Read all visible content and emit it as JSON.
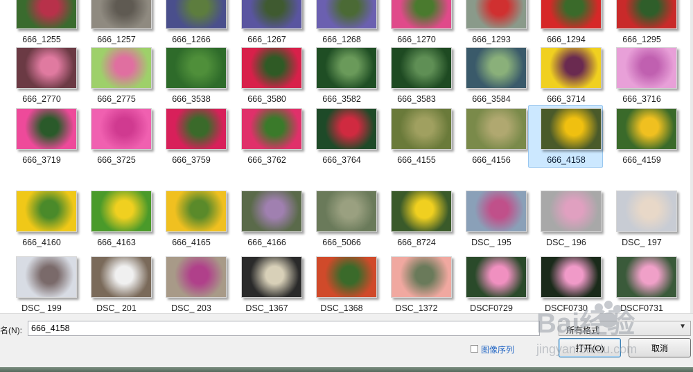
{
  "thumbnails": [
    {
      "name": "666_1255",
      "c1": "#3a6b2e",
      "c2": "#b8314a"
    },
    {
      "name": "666_1257",
      "c1": "#8f8a80",
      "c2": "#5f5a52"
    },
    {
      "name": "666_1266",
      "c1": "#4a4f8c",
      "c2": "#5d7d3e"
    },
    {
      "name": "666_1267",
      "c1": "#5a55a0",
      "c2": "#3f5a30"
    },
    {
      "name": "666_1268",
      "c1": "#6b60b0",
      "c2": "#4b6a35"
    },
    {
      "name": "666_1270",
      "c1": "#e04a8a",
      "c2": "#4a7a2e"
    },
    {
      "name": "666_1293",
      "c1": "#8a9a8a",
      "c2": "#d03030"
    },
    {
      "name": "666_1294",
      "c1": "#d62828",
      "c2": "#3a6a2a"
    },
    {
      "name": "666_1295",
      "c1": "#c92a2a",
      "c2": "#2f5e2a"
    },
    {
      "name": "666_2770",
      "c1": "#6b3a44",
      "c2": "#e07aa0"
    },
    {
      "name": "666_2775",
      "c1": "#9ed06a",
      "c2": "#e06fa0"
    },
    {
      "name": "666_3538",
      "c1": "#2e6b2a",
      "c2": "#4f8f3a"
    },
    {
      "name": "666_3580",
      "c1": "#d8204a",
      "c2": "#2f5a25"
    },
    {
      "name": "666_3582",
      "c1": "#1f4e24",
      "c2": "#6a9a5a"
    },
    {
      "name": "666_3583",
      "c1": "#1e4a22",
      "c2": "#5f8f55"
    },
    {
      "name": "666_3584",
      "c1": "#3a5a6a",
      "c2": "#8ab07a"
    },
    {
      "name": "666_3714",
      "c1": "#f0d020",
      "c2": "#6a2a50"
    },
    {
      "name": "666_3716",
      "c1": "#e8a0d8",
      "c2": "#c060b0"
    },
    {
      "name": "666_3719",
      "c1": "#ee4a9a",
      "c2": "#2a5a2a"
    },
    {
      "name": "666_3725",
      "c1": "#f060b0",
      "c2": "#d03a90"
    },
    {
      "name": "666_3759",
      "c1": "#d8205a",
      "c2": "#3a6a2a"
    },
    {
      "name": "666_3762",
      "c1": "#e0306a",
      "c2": "#3a7a2a"
    },
    {
      "name": "666_3764",
      "c1": "#1e4a28",
      "c2": "#d02a40"
    },
    {
      "name": "666_4155",
      "c1": "#6a7a3a",
      "c2": "#a0a060"
    },
    {
      "name": "666_4156",
      "c1": "#7a8a4a",
      "c2": "#b0a870"
    },
    {
      "name": "666_4158",
      "c1": "#4a5a2a",
      "c2": "#f0c010"
    },
    {
      "name": "666_4159",
      "c1": "#3a6a2a",
      "c2": "#f0c020"
    },
    {
      "name": "666_4160",
      "c1": "#f0c818",
      "c2": "#4a8a2a"
    },
    {
      "name": "666_4163",
      "c1": "#4a9a2a",
      "c2": "#f0d020"
    },
    {
      "name": "666_4165",
      "c1": "#f0c020",
      "c2": "#5a8a2a"
    },
    {
      "name": "666_4166",
      "c1": "#5a6a4a",
      "c2": "#a080b0"
    },
    {
      "name": "666_5066",
      "c1": "#6a7a5a",
      "c2": "#9aa080"
    },
    {
      "name": "666_8724",
      "c1": "#3a5a2a",
      "c2": "#f0d020"
    },
    {
      "name": "DSC_ 195",
      "c1": "#8aa0b8",
      "c2": "#c0508a"
    },
    {
      "name": "DSC_ 196",
      "c1": "#a8a8a8",
      "c2": "#e0a0c0"
    },
    {
      "name": "DSC_ 197",
      "c1": "#c8ccd4",
      "c2": "#e8d8c8"
    },
    {
      "name": "DSC_ 199",
      "c1": "#d8dce4",
      "c2": "#7a6a6a"
    },
    {
      "name": "DSC_ 201",
      "c1": "#7a6a5a",
      "c2": "#f0f0f0"
    },
    {
      "name": "DSC_ 203",
      "c1": "#a89a88",
      "c2": "#b0408a"
    },
    {
      "name": "DSC_1367",
      "c1": "#2a2a2a",
      "c2": "#d8d0b8"
    },
    {
      "name": "DSC_1368",
      "c1": "#d04a2a",
      "c2": "#3a6a2a"
    },
    {
      "name": "DSC_1372",
      "c1": "#f0a8a0",
      "c2": "#6a7a5a"
    },
    {
      "name": "DSCF0729",
      "c1": "#2a4a2a",
      "c2": "#f090c0"
    },
    {
      "name": "DSCF0730",
      "c1": "#1a2a1a",
      "c2": "#f09ac8"
    },
    {
      "name": "DSCF0731",
      "c1": "#3a5a3a",
      "c2": "#f0a0c8"
    }
  ],
  "selected_index": 25,
  "filename_label": "名(N):",
  "filename_value": "666_4158",
  "filter_text": "所有格式",
  "image_sequence_label": "图像序列",
  "open_button": "打开(O)",
  "cancel_button": "取消",
  "watermark_text": "Bai经验",
  "watermark_sub": "jingyan.baidu.com"
}
